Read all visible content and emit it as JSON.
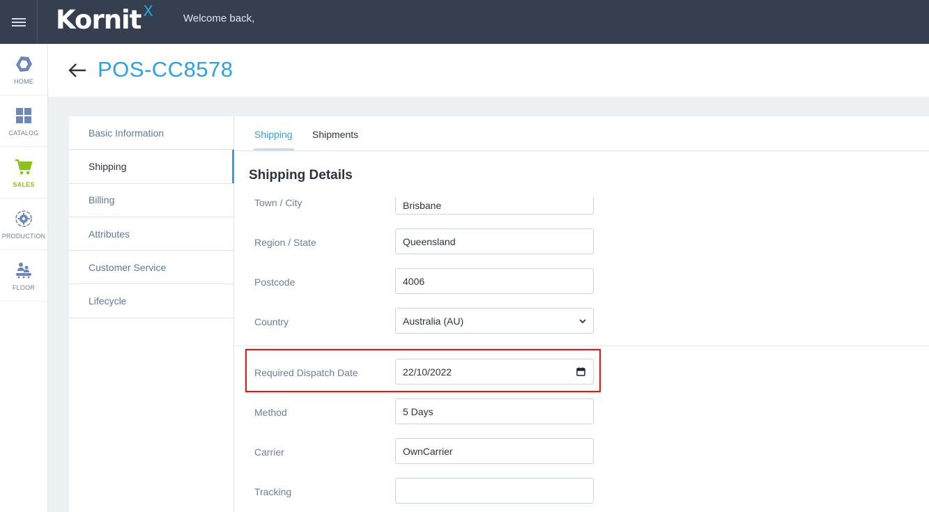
{
  "topbar": {
    "logo_text": "Kornit",
    "logo_superscript": "X",
    "welcome": "Welcome back,"
  },
  "leftnav": {
    "items": [
      {
        "label": "HOME",
        "icon": "hexagon-icon"
      },
      {
        "label": "CATALOG",
        "icon": "grid-icon"
      },
      {
        "label": "SALES",
        "icon": "cart-icon",
        "active": true
      },
      {
        "label": "PRODUCTION",
        "icon": "production-gear-icon"
      },
      {
        "label": "FLOOR",
        "icon": "floor-workers-icon"
      }
    ]
  },
  "header": {
    "title": "POS-CC8578"
  },
  "section_menu": {
    "items": [
      {
        "label": "Basic Information"
      },
      {
        "label": "Shipping",
        "active": true
      },
      {
        "label": "Billing"
      },
      {
        "label": "Attributes"
      },
      {
        "label": "Customer Service"
      },
      {
        "label": "Lifecycle"
      }
    ]
  },
  "tabs": [
    {
      "label": "Shipping",
      "active": true
    },
    {
      "label": "Shipments"
    }
  ],
  "shipping": {
    "title": "Shipping Details",
    "fields": {
      "town": {
        "label": "Town / City",
        "value": "Brisbane"
      },
      "region": {
        "label": "Region / State",
        "value": "Queensland"
      },
      "postcode": {
        "label": "Postcode",
        "value": "4006"
      },
      "country": {
        "label": "Country",
        "value": "Australia (AU)"
      },
      "dispatch_date": {
        "label": "Required Dispatch Date",
        "value": "22/10/2022"
      },
      "method": {
        "label": "Method",
        "value": "5 Days"
      },
      "carrier": {
        "label": "Carrier",
        "value": "OwnCarrier"
      },
      "tracking": {
        "label": "Tracking",
        "value": ""
      }
    }
  },
  "colors": {
    "topbar": "#353f4f",
    "accent_blue": "#2ea0e4",
    "sales_green": "#8dbf1f",
    "highlight_red": "#d11f1f"
  }
}
